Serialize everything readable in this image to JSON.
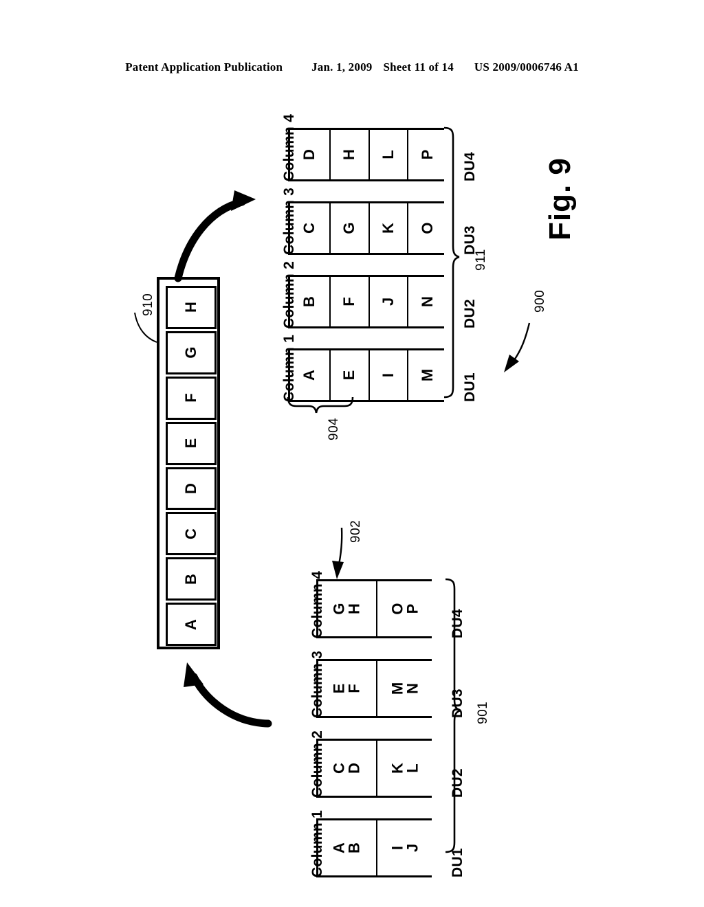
{
  "header": {
    "publication": "Patent Application Publication",
    "date": "Jan. 1, 2009",
    "sheet": "Sheet 11 of 14",
    "patent_number": "US 2009/0006746 A1"
  },
  "figure": {
    "title": "Fig. 9",
    "overall_ref": "900"
  },
  "list": {
    "ref": "910",
    "items": [
      "A",
      "B",
      "C",
      "D",
      "E",
      "F",
      "G",
      "H"
    ]
  },
  "striped_layout": {
    "ref": "911",
    "group_ref": "904",
    "column_labels": [
      "Column 1",
      "Column 2",
      "Column 3",
      "Column 4"
    ],
    "du_labels": [
      "DU1",
      "DU2",
      "DU3",
      "DU4"
    ],
    "columns": [
      {
        "label": "Column 1",
        "du": "DU1",
        "cells": [
          "A",
          "E",
          "I",
          "M"
        ]
      },
      {
        "label": "Column 2",
        "du": "DU2",
        "cells": [
          "B",
          "F",
          "J",
          "N"
        ]
      },
      {
        "label": "Column 3",
        "du": "DU3",
        "cells": [
          "C",
          "G",
          "K",
          "O"
        ]
      },
      {
        "label": "Column 4",
        "du": "DU4",
        "cells": [
          "D",
          "H",
          "L",
          "P"
        ]
      }
    ]
  },
  "blocked_layout": {
    "ref": "901",
    "pointer_ref": "902",
    "column_labels": [
      "Column 1",
      "Column 2",
      "Column 3",
      "Column 4"
    ],
    "du_labels": [
      "DU1",
      "DU2",
      "DU3",
      "DU4"
    ],
    "columns": [
      {
        "label": "Column 1",
        "du": "DU1",
        "cells": [
          "A B",
          "I J"
        ]
      },
      {
        "label": "Column 2",
        "du": "DU2",
        "cells": [
          "C D",
          "K L"
        ]
      },
      {
        "label": "Column 3",
        "du": "DU3",
        "cells": [
          "E F",
          "M N"
        ]
      },
      {
        "label": "Column 4",
        "du": "DU4",
        "cells": [
          "G H",
          "O P"
        ]
      }
    ]
  },
  "colors": {
    "ink": "#000000",
    "paper": "#ffffff"
  }
}
